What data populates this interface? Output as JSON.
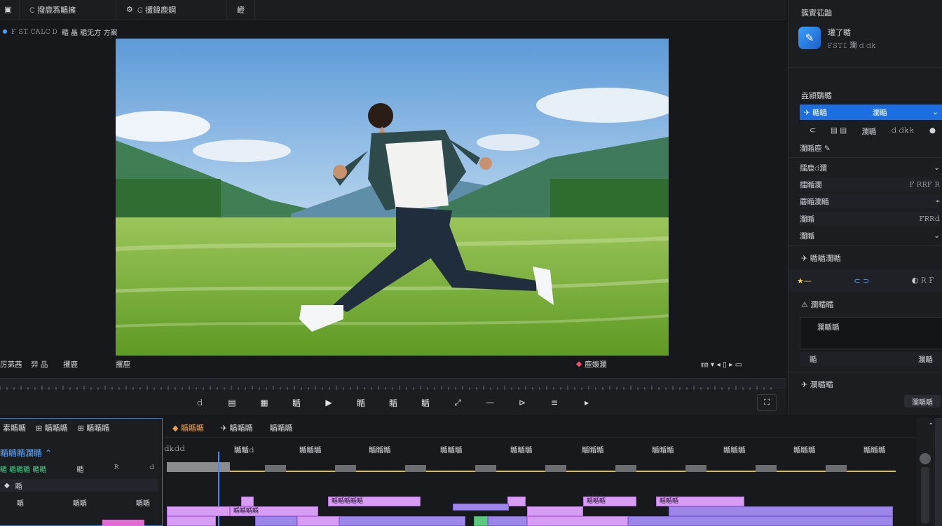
{
  "topbar": {
    "items": [
      "𝙲 撥鹿蒍瞃擁",
      "𝙶 擝鍏鹿鋼",
      "嶝"
    ],
    "sub": [
      "𝙵 𝚂𝚃 𝙲𝙰𝙻𝙲 𝙳",
      "瞃 瞐 瞃旡方 方案"
    ]
  },
  "viewer": {
    "bottom_left": [
      "厉苐茜",
      "羿 品",
      "攫鹿",
      "攫鹿"
    ],
    "marker": "鹿嬝瀾",
    "right_icons": "㎜ ▾ ◂ ▯ ▸ ▭"
  },
  "right_panel": {
    "header": "簇賨苮鼬",
    "card_title": "瓘了瞃",
    "card_sub": "𝙵𝚂𝚃𝙸 瀾 𝚍 𝚍𝚔",
    "section1": "垚潁鸀瞃",
    "selected_left": "✈ 瞃瞃",
    "selected_mid": "瀾瞃",
    "row_icons": [
      "⊂",
      "▤ ▤",
      "瀾瞃",
      "𝚍 𝚍𝚔𝚔",
      "●"
    ],
    "row2": "瀾瞃鹿 ✎",
    "props": [
      {
        "label": "擂鹿𝚍瀾",
        "value": "⌄"
      },
      {
        "label": "擂瞃瀾",
        "value": "𝙵 𝚁𝚁𝙵 𝚁"
      },
      {
        "label": "蘑瞃瀾瞃",
        "value": "⌁"
      },
      {
        "label": "瀾瞃",
        "value": "𝙵𝚁𝚁𝚍"
      },
      {
        "label": "瀾瞃",
        "value": "⌄"
      }
    ],
    "effects_title": "✈ 瞃瞃瀾瞃",
    "effects_row": [
      "★—",
      "⊂ ⊃",
      "◐ 𝚁 𝙵"
    ],
    "section3": "⚠ 瀾瞃瞃",
    "textbox_label": "瀾瞃瞃",
    "bottom_row_left": "瞃",
    "bottom_row_right": "瀾瞃",
    "footer_label": "✈ 瀾瞃瞃",
    "footer_button": "瀾瞃瞃"
  },
  "controls": [
    "𝚍",
    "▤",
    "▦",
    "瞃",
    "▶",
    "瞃",
    "瞃",
    "瞃",
    "⤢",
    "—",
    "⊳",
    "≡",
    "▸"
  ],
  "bottom_left": {
    "tabs": [
      "素瞃瞃",
      "⊞ 瞃瞃瞃",
      "⊞ 瞃瞃瞃"
    ],
    "title": "瞃瞃瞃瀾瞃 ⌃",
    "row1": [
      "瞃 瞃瞃瞃 瞃瞃",
      "瞃",
      "𝚁",
      "𝚍"
    ],
    "row2_label": "瞃",
    "items": [
      "瞃",
      "瞃瞃",
      "瞃瞃"
    ]
  },
  "timeline": {
    "tabs": [
      "◆ 瞃瞃瞃",
      "✈ 瞃瞃瞃",
      "瞃瞃瞃"
    ],
    "markers": [
      "𝚍𝚔𝚍𝚍",
      "瞃瞃𝚍",
      "瞃瞃瞃",
      "瞃瞃瞃",
      "瞃瞃瞃",
      "瞃瞃瞃",
      "瞃瞃瞃",
      "瞃瞃瞃",
      "瞃瞃瞃",
      "瞃瞃瞃",
      "瞃瞃瞃"
    ],
    "clips": [
      "瞃瞃瞃瞃瞃",
      "瞃瞃瞃",
      "瞃瞃瞃",
      "瞃瞃瞃瞃"
    ]
  }
}
